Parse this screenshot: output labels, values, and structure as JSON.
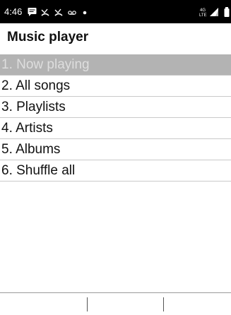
{
  "status_bar": {
    "time": "4:46",
    "icons": [
      "message-icon",
      "missed-call-icon",
      "missed-call-icon",
      "voicemail-icon",
      "dot-icon",
      "lte-icon",
      "signal-icon",
      "battery-icon"
    ],
    "network_top": "4G",
    "network_bottom": "LTE"
  },
  "header": {
    "title": "Music player"
  },
  "menu": {
    "selected_index": 0,
    "items": [
      {
        "label": "1. Now playing"
      },
      {
        "label": "2. All songs"
      },
      {
        "label": "3. Playlists"
      },
      {
        "label": "4. Artists"
      },
      {
        "label": "5. Albums"
      },
      {
        "label": "6. Shuffle all"
      }
    ]
  },
  "softkeys": {
    "left": "",
    "center": "",
    "right": ""
  },
  "colors": {
    "status_bar_bg": "#000000",
    "selected_bg": "#b3b3b3",
    "selected_text": "#dedede",
    "divider": "#c9c9c9"
  }
}
